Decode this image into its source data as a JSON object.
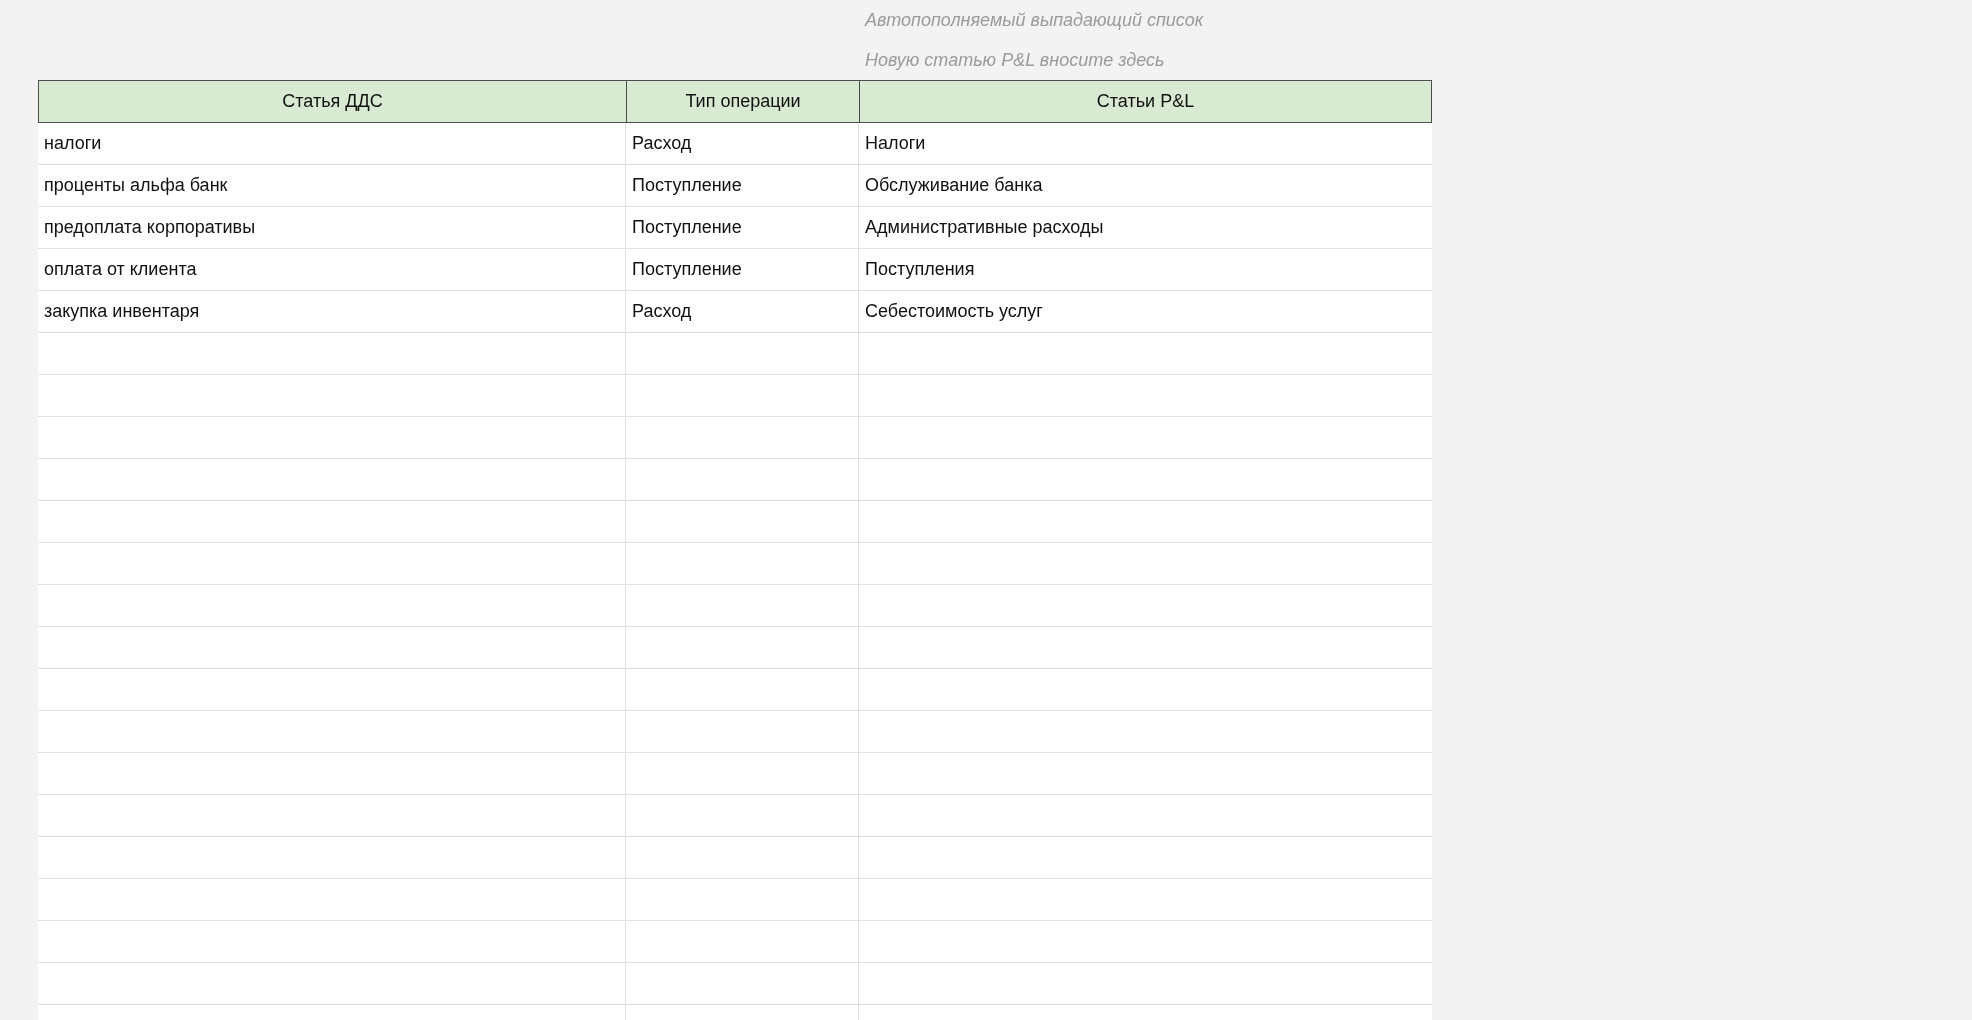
{
  "notes": [
    "Автопополняемый выпадающий список",
    "Новую статью P&L вносите здесь"
  ],
  "table": {
    "columns": [
      "Статья ДДС",
      "Тип операции",
      "Статьи  P&L"
    ],
    "rows": [
      [
        "налоги",
        "Расход",
        "Налоги"
      ],
      [
        "проценты альфа банк",
        "Поступление",
        "Обслуживание банка"
      ],
      [
        "предоплата корпоративы",
        "Поступление",
        "Административные расходы"
      ],
      [
        "оплата от клиента",
        "Поступление",
        "Поступления"
      ],
      [
        "закупка инвентаря",
        "Расход",
        "Себестоимость услуг"
      ]
    ]
  }
}
